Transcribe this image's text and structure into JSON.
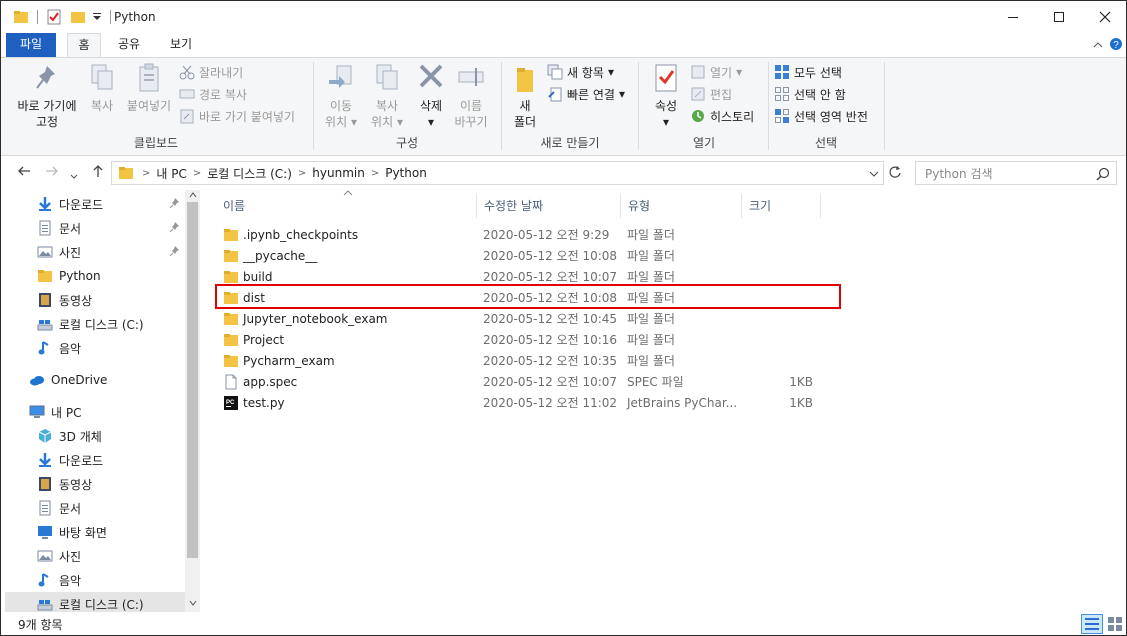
{
  "window": {
    "title": "Python"
  },
  "ribbon_tabs": {
    "file": "파일",
    "home": "홈",
    "share": "공유",
    "view": "보기"
  },
  "ribbon": {
    "clipboard": {
      "label": "클립보드",
      "pin": "바로 가기에\n고정",
      "pin_line1": "바로 가기에",
      "pin_line2": "고정",
      "copy": "복사",
      "paste": "붙여넣기",
      "cut": "잘라내기",
      "copy_path": "경로 복사",
      "paste_shortcut": "바로 가기 붙여넣기"
    },
    "organize": {
      "label": "구성",
      "move_1": "이동",
      "move_2": "위치",
      "copy_1": "복사",
      "copy_2": "위치",
      "delete": "삭제",
      "rename_1": "이름",
      "rename_2": "바꾸기"
    },
    "new": {
      "label": "새로 만들기",
      "folder_1": "새",
      "folder_2": "폴더",
      "new_item": "새 항목",
      "easy_access": "빠른 연결"
    },
    "open": {
      "label": "열기",
      "properties": "속성",
      "open": "열기",
      "edit": "편집",
      "history": "히스토리"
    },
    "select": {
      "label": "선택",
      "select_all": "모두 선택",
      "select_none": "선택 안 함",
      "invert": "선택 영역 반전"
    }
  },
  "address": {
    "crumbs": [
      "내 PC",
      "로컬 디스크 (C:)",
      "hyunmin",
      "Python"
    ],
    "search_placeholder": "Python 검색"
  },
  "nav": {
    "quick": [
      {
        "label": "다운로드",
        "icon": "download-icon",
        "pinned": true
      },
      {
        "label": "문서",
        "icon": "document-icon",
        "pinned": true
      },
      {
        "label": "사진",
        "icon": "picture-icon",
        "pinned": true
      },
      {
        "label": "Python",
        "icon": "folder-icon",
        "pinned": false
      },
      {
        "label": "동영상",
        "icon": "video-icon",
        "pinned": false
      },
      {
        "label": "로컬 디스크 (C:)",
        "icon": "drive-icon",
        "pinned": false
      },
      {
        "label": "음악",
        "icon": "music-icon",
        "pinned": false
      }
    ],
    "onedrive": "OneDrive",
    "thispc": "내 PC",
    "pc_items": [
      {
        "label": "3D 개체",
        "icon": "cube-icon"
      },
      {
        "label": "다운로드",
        "icon": "download-icon"
      },
      {
        "label": "동영상",
        "icon": "video-icon"
      },
      {
        "label": "문서",
        "icon": "document-icon"
      },
      {
        "label": "바탕 화면",
        "icon": "desktop-icon"
      },
      {
        "label": "사진",
        "icon": "picture-icon"
      },
      {
        "label": "음악",
        "icon": "music-icon"
      },
      {
        "label": "로컬 디스크 (C:)",
        "icon": "drive-icon"
      }
    ]
  },
  "columns": {
    "name": "이름",
    "date": "수정한 날짜",
    "type": "유형",
    "size": "크기"
  },
  "files": [
    {
      "name": ".ipynb_checkpoints",
      "date": "2020-05-12 오전 9:29",
      "type": "파일 폴더",
      "size": "",
      "icon": "folder-icon"
    },
    {
      "name": "__pycache__",
      "date": "2020-05-12 오전 10:08",
      "type": "파일 폴더",
      "size": "",
      "icon": "folder-icon"
    },
    {
      "name": "build",
      "date": "2020-05-12 오전 10:07",
      "type": "파일 폴더",
      "size": "",
      "icon": "folder-icon"
    },
    {
      "name": "dist",
      "date": "2020-05-12 오전 10:08",
      "type": "파일 폴더",
      "size": "",
      "icon": "folder-icon"
    },
    {
      "name": "Jupyter_notebook_exam",
      "date": "2020-05-12 오전 10:45",
      "type": "파일 폴더",
      "size": "",
      "icon": "folder-icon"
    },
    {
      "name": "Project",
      "date": "2020-05-12 오전 10:16",
      "type": "파일 폴더",
      "size": "",
      "icon": "folder-icon"
    },
    {
      "name": "Pycharm_exam",
      "date": "2020-05-12 오전 10:35",
      "type": "파일 폴더",
      "size": "",
      "icon": "folder-icon"
    },
    {
      "name": "app.spec",
      "date": "2020-05-12 오전 10:07",
      "type": "SPEC 파일",
      "size": "1KB",
      "icon": "file-icon"
    },
    {
      "name": "test.py",
      "date": "2020-05-12 오전 11:02",
      "type": "JetBrains PyChar...",
      "size": "1KB",
      "icon": "pycharm-icon"
    }
  ],
  "status": {
    "count": "9개 항목"
  },
  "colors": {
    "accent": "#1f5fbf",
    "highlight": "#e00000",
    "folder": "#f3c344"
  }
}
